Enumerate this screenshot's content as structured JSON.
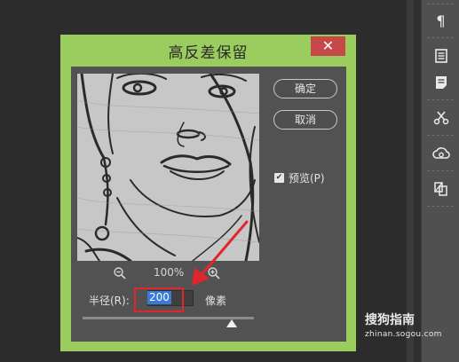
{
  "dialog": {
    "title": "高反差保留",
    "close_label": "✕",
    "ok_label": "确定",
    "cancel_label": "取消",
    "preview_checkbox": {
      "label": "预览(P)",
      "checked": true
    },
    "zoom": {
      "level": "100%",
      "zoom_out_icon": "zoom-out-icon",
      "zoom_in_icon": "zoom-in-icon"
    },
    "radius": {
      "label": "半径(R):",
      "value": "200",
      "unit": "像素"
    },
    "slider": {
      "position_fraction": 0.87
    },
    "accent_color": "#9acd5d",
    "highlight_color": "#e2252d"
  },
  "right_panel": {
    "icons": [
      "paragraph-icon",
      "document-icon",
      "notes-icon",
      "tools-icon",
      "creative-cloud-icon",
      "layer-comps-icon"
    ]
  },
  "watermark": {
    "logo": "搜狗指南",
    "url": "zhinan.sogou.com"
  }
}
